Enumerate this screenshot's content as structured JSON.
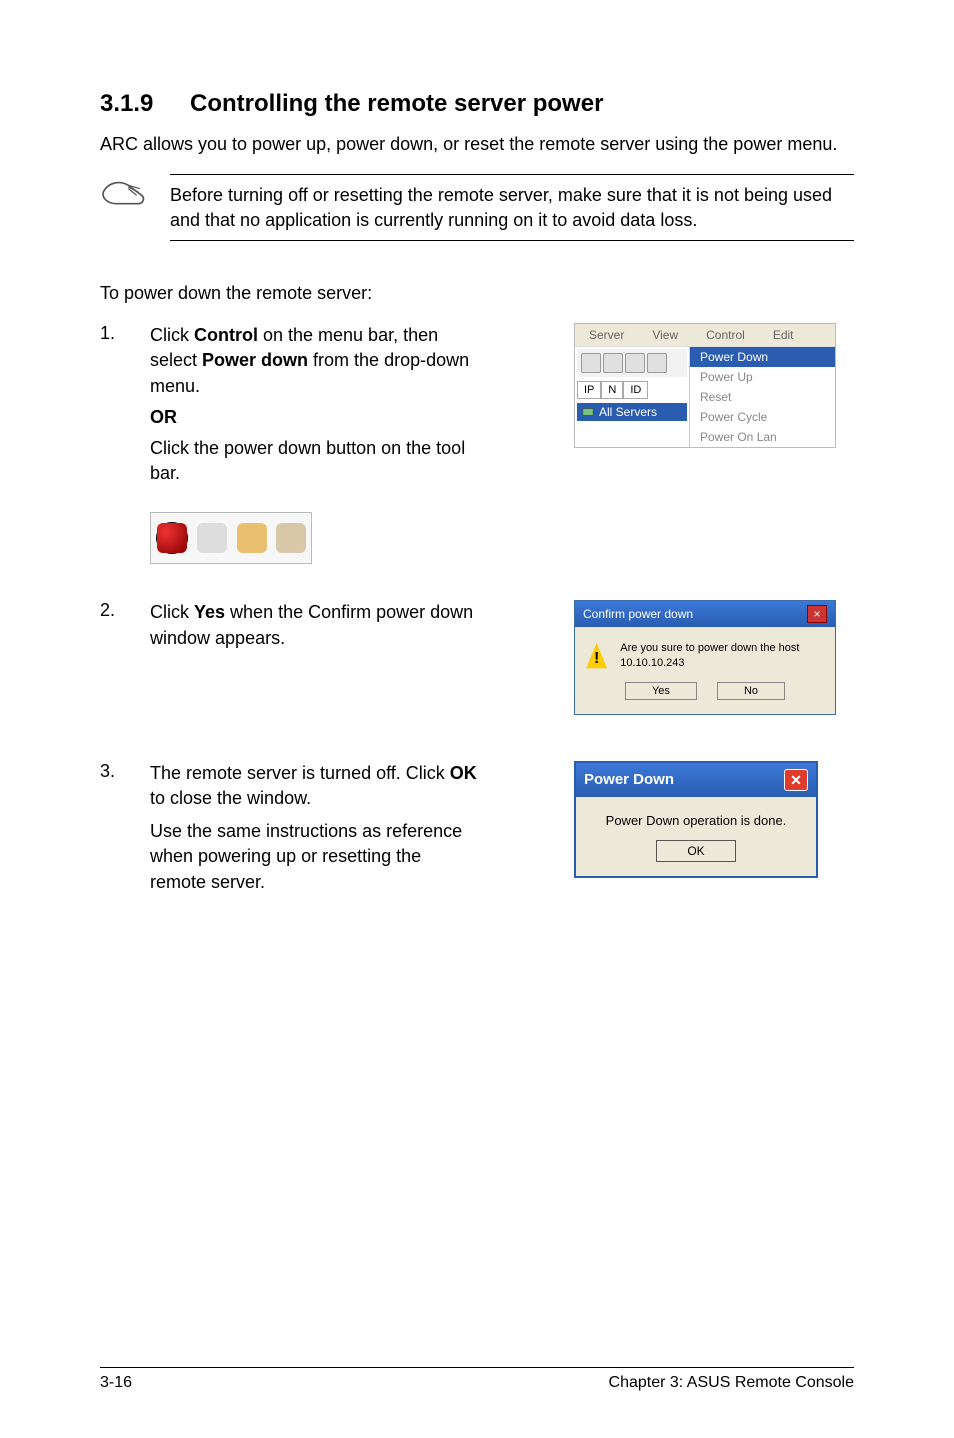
{
  "heading_num": "3.1.9",
  "heading_text": "Controlling the remote server power",
  "intro_para": "ARC allows you to power up, power down, or reset the remote server using the power menu.",
  "note": "Before turning off or resetting the remote server, make sure that it is not being used and that no application is currently running on it to avoid data loss.",
  "lead_in": "To power down the remote server:",
  "steps": {
    "1": {
      "num": "1.",
      "line1a": "Click ",
      "control": "Control",
      "line1b": " on the menu bar, then select ",
      "powerdown": "Power down",
      "line1c": " from the drop-down menu.",
      "or": "OR",
      "line2": "Click the power down button on the tool bar."
    },
    "2": {
      "num": "2.",
      "line_a": "Click ",
      "yes": "Yes",
      "line_b": " when the Confirm power down window appears."
    },
    "3": {
      "num": "3.",
      "line_a": "The remote server is turned off. Click ",
      "ok": "OK",
      "line_b": " to close the window.",
      "line_c": "Use the same instructions as reference when powering up or resetting the remote server."
    }
  },
  "menufig": {
    "menubar": [
      "Server",
      "View",
      "Control",
      "Edit"
    ],
    "tabs": [
      "IP",
      "N",
      "ID"
    ],
    "allservers": "All Servers",
    "items": [
      "Power Down",
      "Power Up",
      "Reset",
      "Power Cycle",
      "Power On Lan"
    ]
  },
  "confirm_dlg": {
    "title": "Confirm power down",
    "msg": "Are you sure to power down the host 10.10.10.243",
    "yes": "Yes",
    "no": "No"
  },
  "done_dlg": {
    "title": "Power Down",
    "msg": "Power Down operation is done.",
    "ok": "OK"
  },
  "footer_left": "3-16",
  "footer_right": "Chapter 3: ASUS Remote Console"
}
